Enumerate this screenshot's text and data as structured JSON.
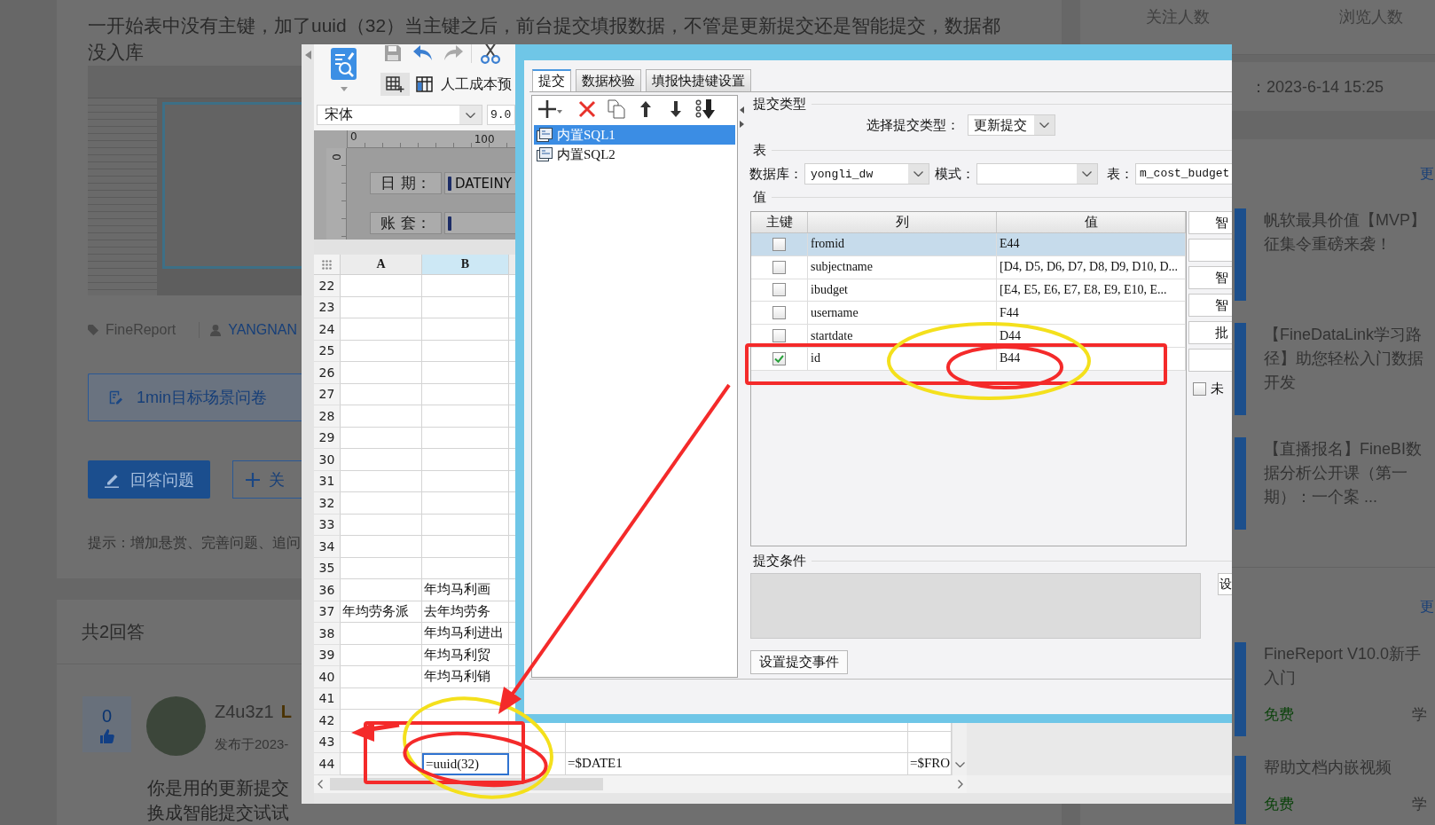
{
  "question": {
    "lines": [
      "一开始表中没有主键，加了uuid（32）当主键之后，前台提交填报数据，不管是更新提交还是智能提交，数据都",
      "没入库"
    ],
    "tags": [
      {
        "kind": "tag",
        "label": "FineReport"
      },
      {
        "kind": "user",
        "label": "YANGNAN"
      }
    ],
    "survey_button": "1min目标场景问卷",
    "answer_button": "回答问题",
    "follow_button": "关",
    "hint": "提示：增加悬赏、完善问题、追问"
  },
  "answers": {
    "count": "共2回答",
    "items": [
      {
        "votes": "0",
        "author": "Z4u3z1",
        "badge": "L",
        "posted": "发布于2023-",
        "lines": [
          "你是用的更新提交",
          "换成智能提交试试"
        ]
      }
    ]
  },
  "sidebar": {
    "stats": [
      "关注人数",
      "浏览人数"
    ],
    "date": "：2023-6-14 15:25",
    "sections": [
      {
        "more": "更",
        "items": [
          {
            "title": "帆软最具价值【MVP】征集令重磅来袭！"
          },
          {
            "title": "【FineDataLink学习路径】助您轻松入门数据开发"
          },
          {
            "title": "【直播报名】FineBI数据分析公开课（第一期）：一个案 ..."
          }
        ]
      },
      {
        "more": "更",
        "items": [
          {
            "title": "FineReport V10.0新手入门",
            "price": "免费",
            "tag": "学"
          },
          {
            "title": "帮助文档内嵌视频",
            "price": "免费",
            "tag": "学"
          }
        ]
      }
    ]
  },
  "designer": {
    "title": "人工成本预",
    "font": "宋体",
    "font_size": "9.0",
    "ruler": [
      "0",
      "100"
    ],
    "vertical_ruler": "0",
    "form": [
      {
        "label": "日 期：",
        "value": "DATEINY"
      },
      {
        "label": "账 套："
      }
    ],
    "columns": [
      {
        "label": "A",
        "selected": false
      },
      {
        "label": "B",
        "selected": true
      }
    ],
    "rows": [
      {
        "number": "22"
      },
      {
        "number": "23"
      },
      {
        "number": "24"
      },
      {
        "number": "25"
      },
      {
        "number": "26"
      },
      {
        "number": "27"
      },
      {
        "number": "28"
      },
      {
        "number": "29"
      },
      {
        "number": "30"
      },
      {
        "number": "31"
      },
      {
        "number": "32"
      },
      {
        "number": "33"
      },
      {
        "number": "34"
      },
      {
        "number": "35"
      },
      {
        "number": "36",
        "cells": [
          null,
          {
            "text": "年均马利画",
            "selected": false
          }
        ]
      },
      {
        "number": "37",
        "cells": [
          {
            "text": "年均劳务派",
            "selected": false
          },
          {
            "text": "去年均劳务",
            "selected": false
          }
        ]
      },
      {
        "number": "38",
        "cells": [
          null,
          {
            "text": "年均马利进出",
            "selected": false
          }
        ]
      },
      {
        "number": "39",
        "cells": [
          null,
          {
            "text": "年均马利贸",
            "selected": false
          }
        ]
      },
      {
        "number": "40",
        "cells": [
          null,
          {
            "text": "年均马利销",
            "selected": false
          }
        ]
      },
      {
        "number": "41"
      },
      {
        "number": "42"
      },
      {
        "number": "43"
      },
      {
        "number": "44",
        "cells": [
          null,
          {
            "text": "=uuid(32)",
            "selected": true
          },
          null,
          {
            "text": "=$DATE1",
            "selected": false
          },
          {
            "text": "=$FRO",
            "selected": false
          }
        ]
      }
    ]
  },
  "dialog": {
    "tabs": [
      {
        "label": "提交",
        "selected": true
      },
      {
        "label": "数据校验",
        "selected": false
      },
      {
        "label": "填报快捷键设置",
        "selected": false
      }
    ],
    "list_items": [
      {
        "label": "内置SQL1",
        "selected": true
      },
      {
        "label": "内置SQL2",
        "selected": false
      }
    ],
    "submit_type": {
      "heading": "提交类型",
      "label": "选择提交类型：",
      "value": "更新提交"
    },
    "table_section": {
      "heading": "表",
      "database_label": "数据库：",
      "database": "yongli_dw",
      "schema_label": "模式：",
      "table_label": "表：",
      "table": "m_cost_budget"
    },
    "values": {
      "heading": "值",
      "columns": [
        "主键",
        "列",
        "值"
      ],
      "rows": [
        {
          "key": false,
          "column": "fromid",
          "value": "E44",
          "selected": true
        },
        {
          "key": false,
          "column": "subjectname",
          "value": "[D4, D5, D6, D7, D8, D9, D10, D...",
          "selected": false
        },
        {
          "key": false,
          "column": "ibudget",
          "value": "[E4, E5, E6, E7, E8, E9, E10, E...",
          "selected": false
        },
        {
          "key": false,
          "column": "username",
          "value": "F44",
          "selected": false
        },
        {
          "key": false,
          "column": "startdate",
          "value": "D44",
          "selected": false
        },
        {
          "key": true,
          "column": "id",
          "value": "B44",
          "selected": false
        }
      ]
    },
    "side_buttons": [
      {
        "kind": "button",
        "label": "智"
      },
      {
        "kind": "blank"
      },
      {
        "kind": "button",
        "label": "智"
      },
      {
        "kind": "button",
        "label": "智"
      },
      {
        "kind": "button",
        "label": "批"
      },
      {
        "kind": "blank"
      }
    ],
    "unmodified": {
      "label": "未",
      "checked": false
    },
    "condition": {
      "heading": "提交条件",
      "button": "设"
    },
    "event_button": "设置提交事件"
  }
}
